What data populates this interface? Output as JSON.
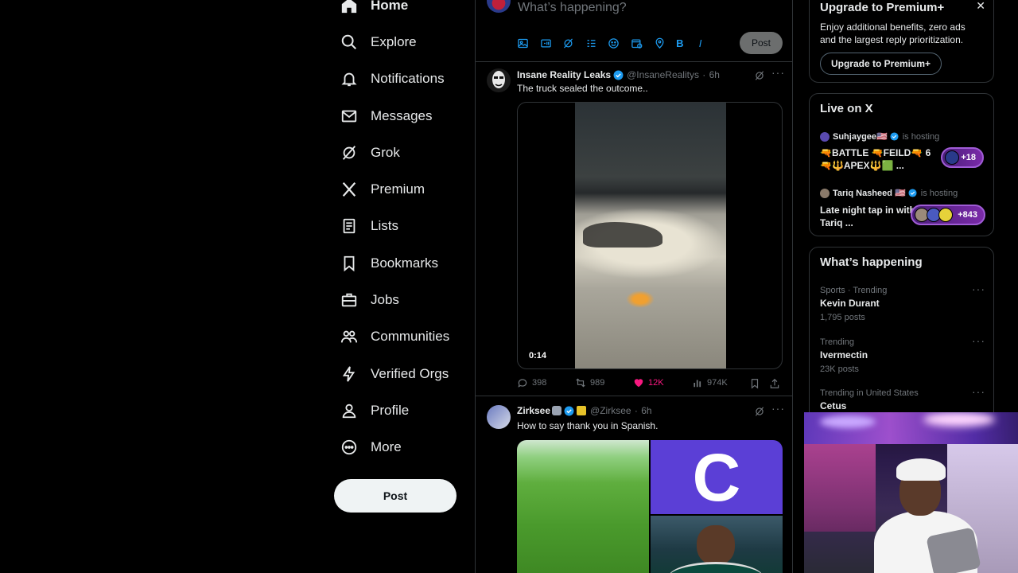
{
  "nav": {
    "items": [
      {
        "label": "Home",
        "icon": "home-icon"
      },
      {
        "label": "Explore",
        "icon": "search-icon"
      },
      {
        "label": "Notifications",
        "icon": "bell-icon"
      },
      {
        "label": "Messages",
        "icon": "envelope-icon"
      },
      {
        "label": "Grok",
        "icon": "grok-icon"
      },
      {
        "label": "Premium",
        "icon": "x-logo-icon"
      },
      {
        "label": "Lists",
        "icon": "list-icon"
      },
      {
        "label": "Bookmarks",
        "icon": "bookmark-icon"
      },
      {
        "label": "Jobs",
        "icon": "briefcase-icon"
      },
      {
        "label": "Communities",
        "icon": "people-icon"
      },
      {
        "label": "Verified Orgs",
        "icon": "lightning-icon"
      },
      {
        "label": "Profile",
        "icon": "person-icon"
      },
      {
        "label": "More",
        "icon": "more-circle-icon"
      }
    ],
    "post_label": "Post"
  },
  "composer": {
    "placeholder": "What’s happening?",
    "post_label": "Post",
    "tools": [
      "image-icon",
      "gif-icon",
      "grok-icon",
      "poll-icon",
      "emoji-icon",
      "schedule-icon",
      "location-icon",
      "bold-icon",
      "italic-icon"
    ],
    "bold_glyph": "B",
    "italic_glyph": "I"
  },
  "tweets": [
    {
      "name": "Insane Reality Leaks",
      "handle": "@InsaneRealitys",
      "time": "6h",
      "text": "The truck sealed the outcome..",
      "video_duration": "0:14",
      "replies": "398",
      "reposts": "989",
      "likes": "12K",
      "views": "974K"
    },
    {
      "name": "Zirksee",
      "handle": "@Zirksee",
      "time": "6h",
      "text": "How to say thank you in Spanish.",
      "tile_letter": "C"
    }
  ],
  "premium": {
    "title": "Upgrade to Premium+",
    "body": "Enjoy additional benefits, zero ads and the largest reply prioritization.",
    "button": "Upgrade to Premium+",
    "close": "✕"
  },
  "live": {
    "title": "Live on X",
    "spaces": [
      {
        "host": "Suhjaygee🇺🇸",
        "status": "is hosting",
        "title": "🔫BATTLE 🔫FEILD🔫 6 🔫🔱APEX🔱🟩 ...",
        "count": "+18"
      },
      {
        "host": "Tariq Nasheed 🇺🇸",
        "status": "is hosting",
        "title": "Late night tap in with Tariq ...",
        "count": "+843"
      }
    ]
  },
  "trends": {
    "title": "What’s happening",
    "items": [
      {
        "meta": "Sports · Trending",
        "name": "Kevin Durant",
        "count": "1,795 posts"
      },
      {
        "meta": "Trending",
        "name": "Ivermectin",
        "count": "23K posts"
      },
      {
        "meta": "Trending in United States",
        "name": "Cetus",
        "count": ""
      }
    ]
  },
  "colors": {
    "accent": "#1d9bf0",
    "like": "#f91880",
    "border": "#2f3336",
    "muted": "#71767b"
  }
}
